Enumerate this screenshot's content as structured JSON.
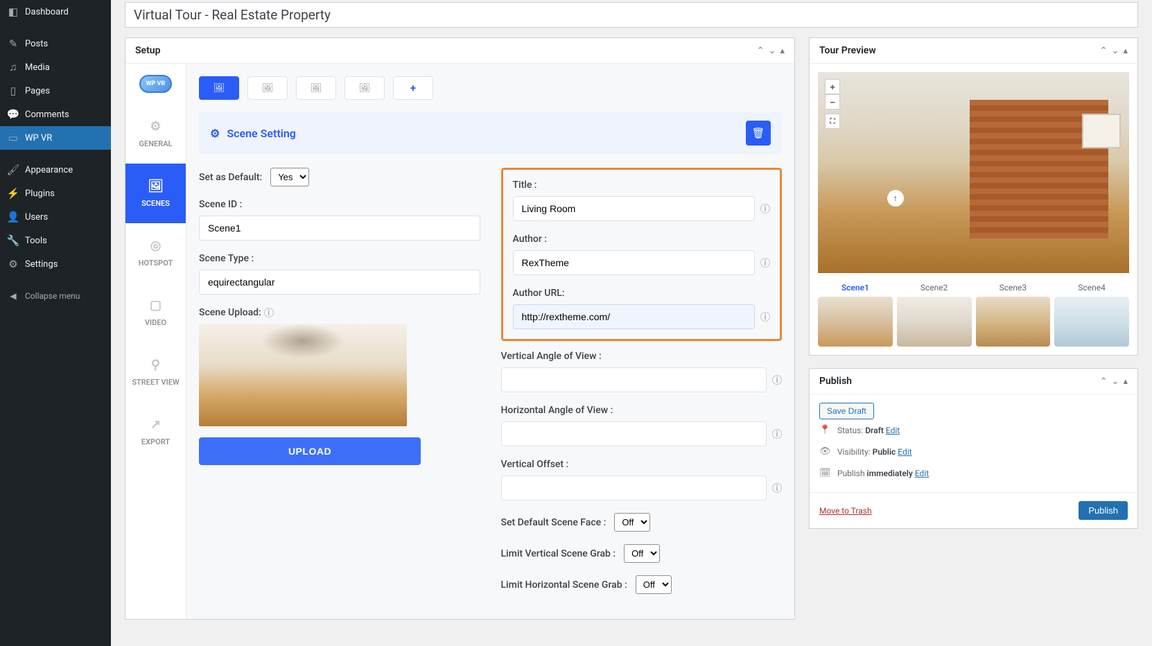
{
  "wp_menu": {
    "dashboard": "Dashboard",
    "posts": "Posts",
    "media": "Media",
    "pages": "Pages",
    "comments": "Comments",
    "wpvr": "WP VR",
    "appearance": "Appearance",
    "plugins": "Plugins",
    "users": "Users",
    "tools": "Tools",
    "settings": "Settings",
    "collapse": "Collapse menu"
  },
  "page_title": "Virtual Tour - Real Estate Property",
  "setup": {
    "panel_title": "Setup",
    "logo_text": "WP VR",
    "vtabs": {
      "general": "GENERAL",
      "scenes": "SCENES",
      "hotspot": "HOTSPOT",
      "video": "VIDEO",
      "street_view": "STREET VIEW",
      "export": "EXPORT"
    },
    "scene_setting_title": "Scene Setting",
    "labels": {
      "set_default": "Set as Default:",
      "scene_id": "Scene ID :",
      "scene_type": "Scene Type :",
      "scene_upload": "Scene Upload:",
      "upload_btn": "UPLOAD",
      "title": "Title :",
      "author": "Author :",
      "author_url": "Author URL:",
      "v_angle": "Vertical Angle of View :",
      "h_angle": "Horizontal Angle of View :",
      "v_offset": "Vertical Offset :",
      "default_face": "Set Default Scene Face :",
      "limit_v": "Limit Vertical Scene Grab :",
      "limit_h": "Limit Horizontal Scene Grab :"
    },
    "values": {
      "set_default_sel": "Yes",
      "scene_id": "Scene1",
      "scene_type": "equirectangular",
      "title": "Living Room",
      "author": "RexTheme",
      "author_url": "http://rextheme.com/",
      "v_angle": "",
      "h_angle": "",
      "v_offset": "",
      "default_face_sel": "Off",
      "limit_v_sel": "Off",
      "limit_h_sel": "Off"
    }
  },
  "preview": {
    "panel_title": "Tour Preview",
    "scenes": [
      "Scene1",
      "Scene2",
      "Scene3",
      "Scene4"
    ]
  },
  "publish": {
    "panel_title": "Publish",
    "save_draft": "Save Draft",
    "status_label": "Status:",
    "status_value": "Draft",
    "visibility_label": "Visibility:",
    "visibility_value": "Public",
    "publish_label": "Publish",
    "publish_value": "immediately",
    "edit": "Edit",
    "move_to_trash": "Move to Trash",
    "publish_btn": "Publish"
  }
}
